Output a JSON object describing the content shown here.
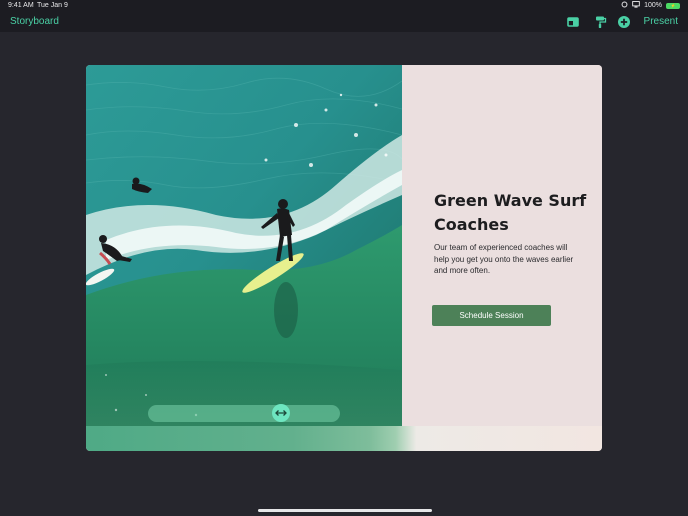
{
  "status_bar": {
    "time": "9:41 AM",
    "date": "Tue Jan 9",
    "battery_percent": "100%",
    "battery_level": 1.0
  },
  "toolbar": {
    "title": "Storyboard",
    "present_label": "Present",
    "icons": [
      "layout-icon",
      "paint-roller-icon",
      "add-circle-icon"
    ]
  },
  "card": {
    "heading": "Green Wave Surf Coaches",
    "body": "Our team of experienced coaches will help you get you onto the waves earlier and more often.",
    "button_label": "Schedule Session",
    "image": "surfers-on-wave-photo",
    "slider_icon": "left-right-arrow-icon"
  },
  "colors": {
    "accent": "#4ad0a5",
    "background": "#26262d",
    "panel": "#ebdfdf",
    "button": "#4d8158"
  }
}
